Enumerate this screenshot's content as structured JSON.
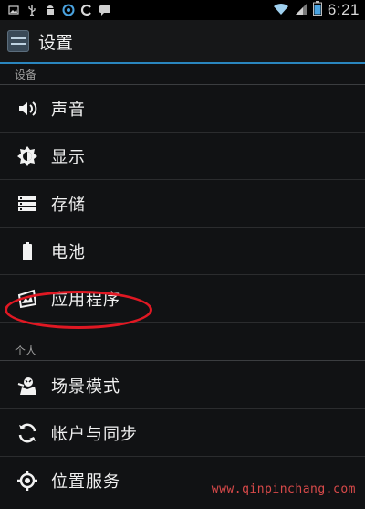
{
  "status_bar": {
    "time": "6:21",
    "left_icons": [
      "image-icon",
      "usb-icon",
      "android-icon",
      "sync-icon",
      "c-icon",
      "message-icon"
    ],
    "right_icons": [
      "wifi-icon",
      "signal-icon",
      "battery-icon"
    ]
  },
  "action_bar": {
    "title": "设置",
    "icon": "settings-app-icon"
  },
  "sections": [
    {
      "header": "设备",
      "items": [
        {
          "label": "声音",
          "icon": "volume-icon"
        },
        {
          "label": "显示",
          "icon": "brightness-icon"
        },
        {
          "label": "存储",
          "icon": "storage-icon"
        },
        {
          "label": "电池",
          "icon": "battery-icon"
        },
        {
          "label": "应用程序",
          "icon": "apps-icon"
        }
      ]
    },
    {
      "header": "个人",
      "items": [
        {
          "label": "场景模式",
          "icon": "profile-icon"
        },
        {
          "label": "帐户与同步",
          "icon": "sync-icon"
        },
        {
          "label": "位置服务",
          "icon": "location-icon"
        }
      ]
    }
  ],
  "annotation": {
    "highlight_color": "#e01823",
    "highlighted_item": "应用程序"
  },
  "watermark": "www.qinpinchang.com",
  "colors": {
    "accent": "#2a86bf",
    "background": "#111214"
  }
}
